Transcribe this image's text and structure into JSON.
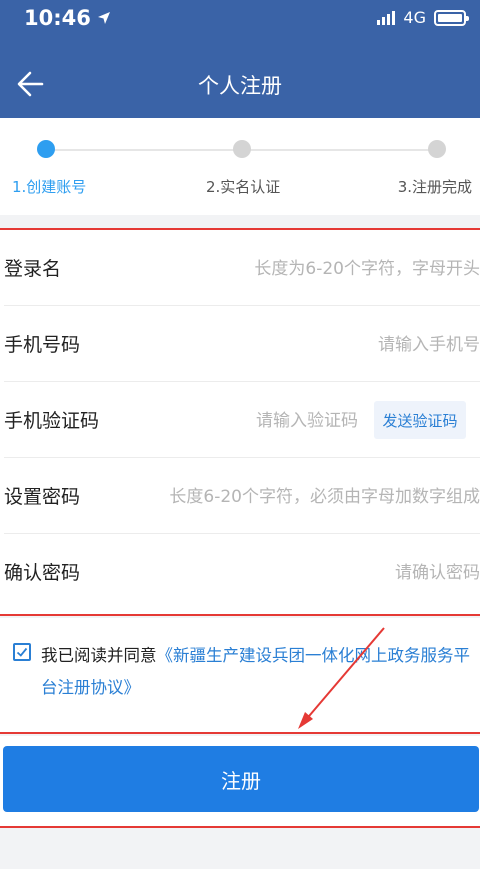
{
  "status_bar": {
    "time": "10:46",
    "network": "4G"
  },
  "header": {
    "title": "个人注册"
  },
  "steps": [
    {
      "label": "1.创建账号",
      "active": true
    },
    {
      "label": "2.实名认证",
      "active": false
    },
    {
      "label": "3.注册完成",
      "active": false
    }
  ],
  "form": {
    "login_name": {
      "label": "登录名",
      "placeholder": "长度为6-20个字符，字母开头"
    },
    "phone": {
      "label": "手机号码",
      "placeholder": "请输入手机号"
    },
    "sms_code": {
      "label": "手机验证码",
      "placeholder": "请输入验证码",
      "button": "发送验证码"
    },
    "password": {
      "label": "设置密码",
      "placeholder": "长度6-20个字符，必须由字母加数字组成"
    },
    "confirm_password": {
      "label": "确认密码",
      "placeholder": "请确认密码"
    }
  },
  "agreement": {
    "checked": true,
    "prefix": "我已阅读并同意",
    "link": "《新疆生产建设兵团一体化网上政务服务平台注册协议》"
  },
  "register_button": "注册",
  "colors": {
    "header_bg": "#3a63a7",
    "accent": "#2e9ef0",
    "button": "#1f7de3",
    "highlight": "#e53935"
  }
}
